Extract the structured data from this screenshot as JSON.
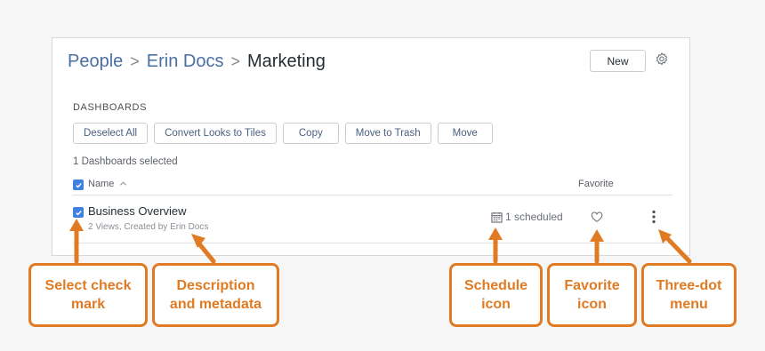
{
  "breadcrumb": {
    "items": [
      {
        "label": "People"
      },
      {
        "label": "Erin Docs"
      },
      {
        "label": "Marketing"
      }
    ],
    "separator": ">"
  },
  "header": {
    "new_label": "New",
    "settings_icon": "gear-icon"
  },
  "section": {
    "title": "DASHBOARDS"
  },
  "actions": [
    {
      "label": "Deselect All"
    },
    {
      "label": "Convert Looks to Tiles"
    },
    {
      "label": "Copy"
    },
    {
      "label": "Move to Trash"
    },
    {
      "label": "Move"
    }
  ],
  "selection": {
    "count_text": "1 Dashboards selected"
  },
  "table": {
    "header": {
      "name": "Name",
      "sort_icon": "chevron-up-icon",
      "favorite": "Favorite"
    },
    "rows": [
      {
        "title": "Business Overview",
        "meta": "2 Views, Created by Erin Docs",
        "scheduled": "1 scheduled",
        "checked": true,
        "favorite": false
      }
    ]
  },
  "callouts": [
    {
      "label": "Select check mark"
    },
    {
      "label": "Description and metadata"
    },
    {
      "label": "Schedule icon"
    },
    {
      "label": "Favorite icon"
    },
    {
      "label": "Three-dot menu"
    }
  ],
  "colors": {
    "accent": "#e07b24",
    "checkbox": "#3f80e0",
    "link": "#4a6fa5"
  }
}
